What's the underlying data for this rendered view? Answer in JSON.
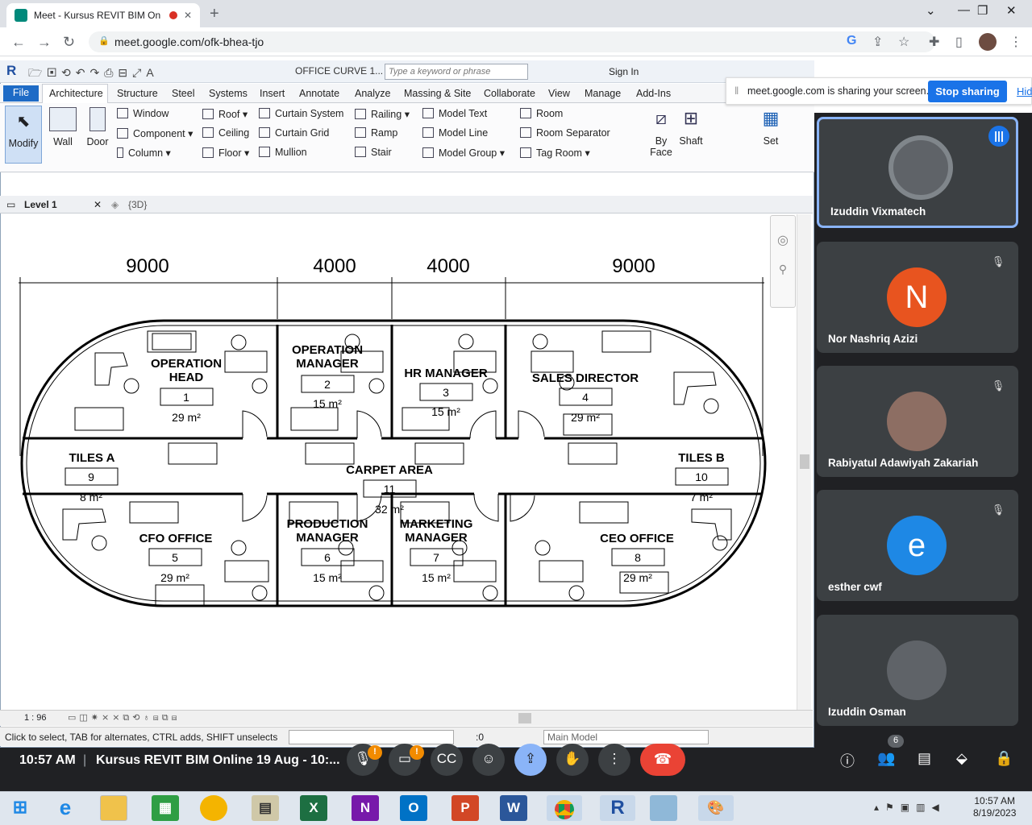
{
  "browser": {
    "tab_title": "Meet - Kursus REVIT BIM On",
    "url": "meet.google.com/ofk-bhea-tjo"
  },
  "revit": {
    "doc_title": "OFFICE CURVE 1...",
    "search_placeholder": "Type a keyword or phrase",
    "sign_in": "Sign In",
    "menu_tabs": [
      "File",
      "Architecture",
      "Structure",
      "Steel",
      "Systems",
      "Insert",
      "Annotate",
      "Analyze",
      "Massing & Site",
      "Collaborate",
      "View",
      "Manage",
      "Add-Ins"
    ],
    "ribbon": {
      "modify": "Modify",
      "wall": "Wall",
      "door": "Door",
      "window": "Window",
      "component": "Component",
      "column": "Column",
      "roof": "Roof",
      "ceiling": "Ceiling",
      "floor": "Floor",
      "curtain_system": "Curtain System",
      "curtain_grid": "Curtain Grid",
      "mullion": "Mullion",
      "railing": "Railing",
      "ramp": "Ramp",
      "stair": "Stair",
      "model_text": "Model Text",
      "model_line": "Model Line",
      "model_group": "Model Group",
      "room": "Room",
      "room_separator": "Room Separator",
      "tag_room": "Tag Room",
      "by_face_1": "By",
      "by_face_2": "Face",
      "shaft": "Shaft",
      "set": "Set"
    },
    "view_tabs": [
      "Level 1",
      "{3D}"
    ],
    "scale": "1 : 96",
    "status_msg": "Click to select, TAB for alternates, CTRL adds, SHIFT unselects",
    "status_count": ":0",
    "model_select": "Main Model"
  },
  "plan": {
    "dimensions": [
      "9000",
      "4000",
      "4000",
      "9000"
    ],
    "rooms": [
      {
        "name": "OPERATION HEAD",
        "name1": "OPERATION",
        "name2": "HEAD",
        "number": "1",
        "area": "29 m²"
      },
      {
        "name1": "OPERATION",
        "name2": "MANAGER",
        "number": "2",
        "area": "15 m²"
      },
      {
        "name1": "HR MANAGER",
        "name2": "",
        "number": "3",
        "area": "15 m²"
      },
      {
        "name1": "SALES DIRECTOR",
        "name2": "",
        "number": "4",
        "area": "29 m²"
      },
      {
        "name1": "CFO OFFICE",
        "name2": "",
        "number": "5",
        "area": "29 m²"
      },
      {
        "name1": "PRODUCTION",
        "name2": "MANAGER",
        "number": "6",
        "area": "15 m²"
      },
      {
        "name1": "MARKETING",
        "name2": "MANAGER",
        "number": "7",
        "area": "15 m²"
      },
      {
        "name1": "CEO OFFICE",
        "name2": "",
        "number": "8",
        "area": "29 m²"
      },
      {
        "name1": "TILES A",
        "name2": "",
        "number": "9",
        "area": "8 m²"
      },
      {
        "name1": "TILES B",
        "name2": "",
        "number": "10",
        "area": "7 m²"
      },
      {
        "name1": "CARPET AREA",
        "name2": "",
        "number": "11",
        "area": "32 m²"
      }
    ]
  },
  "share": {
    "message": "meet.google.com is sharing your screen.",
    "stop": "Stop sharing",
    "hide": "Hide"
  },
  "participants": [
    {
      "name": "Izuddin Vixmatech",
      "avatar": "photo",
      "color": "#5f6368",
      "speaking": true
    },
    {
      "name": "Nor Nashriq Azizi",
      "avatar": "N",
      "color": "#e8541f",
      "muted": true
    },
    {
      "name": "Rabiyatul Adawiyah Zakariah",
      "avatar": "photo",
      "color": "#8d6e63",
      "muted": true
    },
    {
      "name": "esther cwf",
      "avatar": "e",
      "color": "#1e88e5",
      "muted": true
    },
    {
      "name": "Izuddin Osman",
      "avatar": "photo",
      "color": "#5f6368"
    }
  ],
  "meet": {
    "time": "10:57 AM",
    "title": "Kursus REVIT BIM Online 19 Aug - 10:...",
    "people_count": "6",
    "badge": "!"
  },
  "taskbar": {
    "time": "10:57 AM",
    "date": "8/19/2023",
    "apps": [
      "start-icon",
      "ie-icon",
      "explorer-icon",
      "store-icon",
      "chrome-canary-icon",
      "calculator-icon",
      "excel-icon",
      "onenote-icon",
      "outlook-icon",
      "powerpoint-icon",
      "word-icon",
      "chrome-icon",
      "revit-icon",
      "notepad-icon",
      "paint-icon"
    ]
  }
}
